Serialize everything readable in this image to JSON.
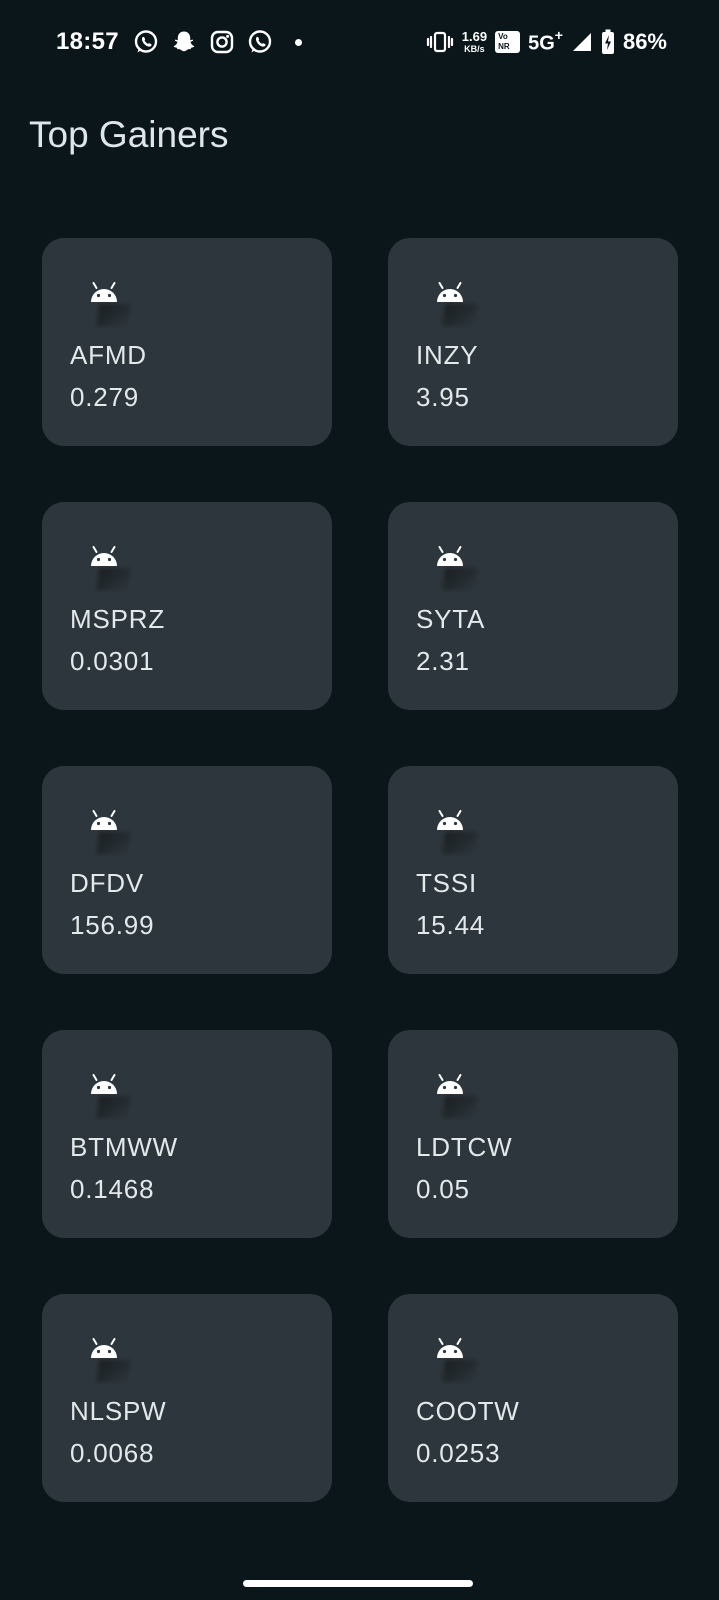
{
  "status_bar": {
    "time": "18:57",
    "net_speed_value": "1.69",
    "net_speed_unit": "KB/s",
    "vonr_label_top": "Vo",
    "vonr_label_bottom": "NR",
    "network_type": "5G",
    "network_plus": "+",
    "battery_percent": "86%",
    "notification_icons": [
      "whatsapp-icon",
      "snapchat-icon",
      "instagram-icon",
      "whatsapp-icon"
    ]
  },
  "page": {
    "title": "Top Gainers"
  },
  "stocks": [
    {
      "symbol": "AFMD",
      "price": "0.279",
      "icon": "android-icon"
    },
    {
      "symbol": "INZY",
      "price": "3.95",
      "icon": "android-icon"
    },
    {
      "symbol": "MSPRZ",
      "price": "0.0301",
      "icon": "android-icon"
    },
    {
      "symbol": "SYTA",
      "price": "2.31",
      "icon": "android-icon"
    },
    {
      "symbol": "DFDV",
      "price": "156.99",
      "icon": "android-icon"
    },
    {
      "symbol": "TSSI",
      "price": "15.44",
      "icon": "android-icon"
    },
    {
      "symbol": "BTMWW",
      "price": "0.1468",
      "icon": "android-icon"
    },
    {
      "symbol": "LDTCW",
      "price": "0.05",
      "icon": "android-icon"
    },
    {
      "symbol": "NLSPW",
      "price": "0.0068",
      "icon": "android-icon"
    },
    {
      "symbol": "COOTW",
      "price": "0.0253",
      "icon": "android-icon"
    }
  ],
  "colors": {
    "background": "#0b161b",
    "card": "#2d363c",
    "text": "#e3e8ea"
  }
}
